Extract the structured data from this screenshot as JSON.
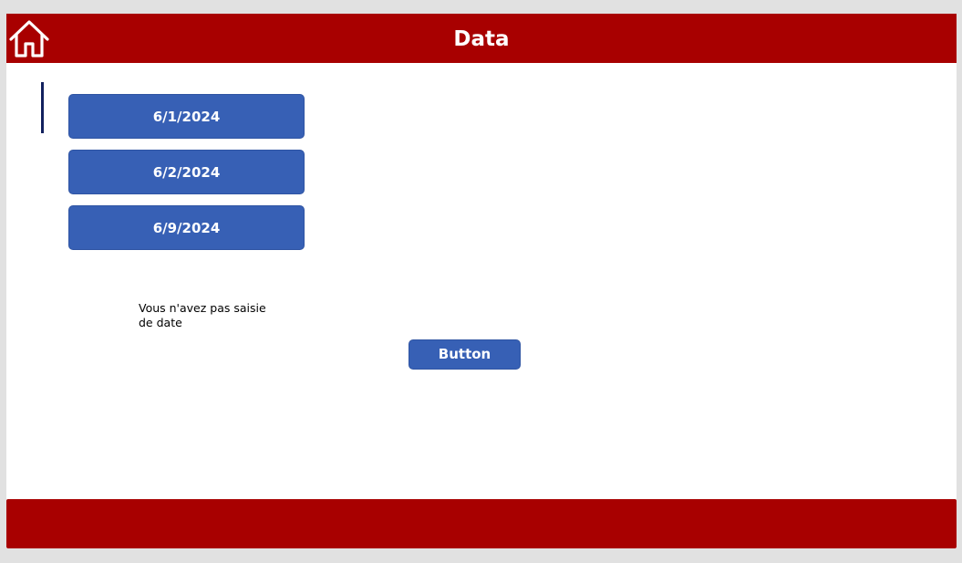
{
  "header": {
    "title": "Data",
    "home_icon": "home-icon",
    "background_color": "#a80000"
  },
  "gallery": {
    "items": [
      {
        "label": "6/1/2024"
      },
      {
        "label": "6/2/2024"
      },
      {
        "label": "6/9/2024"
      }
    ],
    "button_color": "#3760b5"
  },
  "message": {
    "text": "Vous n'avez pas saisie de date"
  },
  "action": {
    "button_label": "Button"
  },
  "footer": {
    "background_color": "#a80000"
  }
}
